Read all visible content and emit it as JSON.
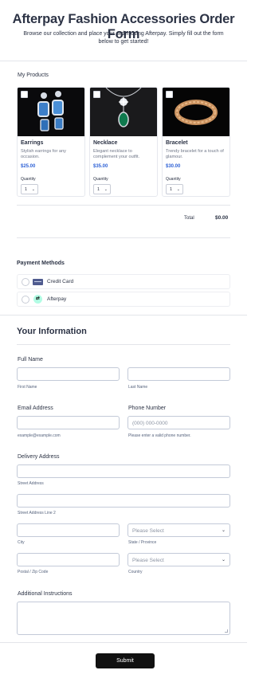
{
  "header": {
    "title": "Afterpay Fashion Accessories Order Form",
    "subtitle": "Browse our collection and place your order using Afterpay. Simply fill out the form below to get started!"
  },
  "products": {
    "section_label": "My Products",
    "items": [
      {
        "name": "Earrings",
        "description": "Stylish earrings for any occasion.",
        "price": "$25.00",
        "quantity_label": "Quantity",
        "quantity": "1",
        "image_icon": "earrings-image"
      },
      {
        "name": "Necklace",
        "description": "Elegant necklace to complement your outfit.",
        "price": "$35.00",
        "quantity_label": "Quantity",
        "quantity": "1",
        "image_icon": "necklace-image"
      },
      {
        "name": "Bracelet",
        "description": "Trendy bracelet for a touch of glamour.",
        "price": "$30.00",
        "quantity_label": "Quantity",
        "quantity": "1",
        "image_icon": "bracelet-image"
      }
    ],
    "total_label": "Total",
    "total_value": "$0.00"
  },
  "payment": {
    "label": "Payment Methods",
    "options": [
      {
        "label": "Credit Card",
        "icon": "credit-card-icon"
      },
      {
        "label": "Afterpay",
        "icon": "afterpay-icon"
      }
    ]
  },
  "info": {
    "heading": "Your Information",
    "full_name_label": "Full Name",
    "first_name_sub": "First Name",
    "last_name_sub": "Last Name",
    "email_label": "Email Address",
    "email_sub": "example@example.com",
    "phone_label": "Phone Number",
    "phone_placeholder": "(000) 000-0000",
    "phone_sub": "Please enter a valid phone number.",
    "delivery_label": "Delivery Address",
    "street_sub": "Street Address",
    "street2_sub": "Street Address Line 2",
    "city_sub": "City",
    "state_placeholder": "Please Select",
    "state_sub": "State / Province",
    "postal_sub": "Postal / Zip Code",
    "country_placeholder": "Please Select",
    "country_sub": "Country",
    "instructions_label": "Additional Instructions"
  },
  "submit_label": "Submit",
  "colors": {
    "accent_price": "#2f62d6",
    "button": "#111111",
    "afterpay_mint": "#b2fce4"
  }
}
